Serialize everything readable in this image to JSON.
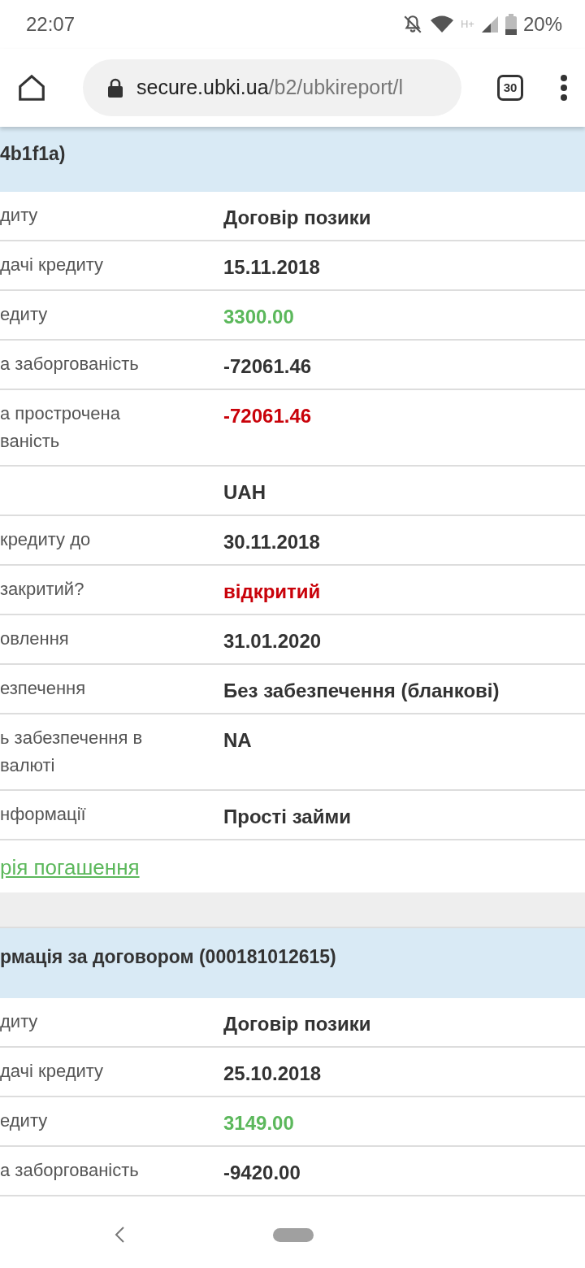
{
  "status_bar": {
    "time": "22:07",
    "network": "H+",
    "battery": "20%"
  },
  "browser": {
    "url_host": "secure.ubki.ua",
    "url_path": "/b2/ubkireport/l",
    "tab_count": "30"
  },
  "sections": [
    {
      "title": "4b1f1a)",
      "rows": [
        {
          "label": [
            "дитy"
          ],
          "value": "Договір позики",
          "color": "#333333"
        },
        {
          "label": [
            "дачі кредиту"
          ],
          "value": "15.11.2018",
          "color": "#333333"
        },
        {
          "label": [
            "едиту"
          ],
          "value": "3300.00",
          "color": "#5cb85c"
        },
        {
          "label": [
            "а заборгованість"
          ],
          "value": "-72061.46",
          "color": "#333333"
        },
        {
          "label": [
            "а прострочена",
            "ваність"
          ],
          "value": "-72061.46",
          "color": "#c9020a"
        },
        {
          "label": [],
          "value": "UAH",
          "color": "#333333"
        },
        {
          "label": [
            "кредиту до"
          ],
          "value": "30.11.2018",
          "color": "#333333"
        },
        {
          "label": [
            "закритий?"
          ],
          "value": "відкритий",
          "color": "#c9020a"
        },
        {
          "label": [
            "овлення"
          ],
          "value": "31.01.2020",
          "color": "#333333"
        },
        {
          "label": [
            "езпечення"
          ],
          "value": "Без забезпечення (бланкові)",
          "color": "#333333"
        },
        {
          "label": [
            "ь забезпечення в",
            "валюті"
          ],
          "value": "NA",
          "color": "#333333"
        },
        {
          "label": [
            "нформації"
          ],
          "value": "Прості займи",
          "color": "#333333"
        }
      ],
      "link": "рія погашення"
    },
    {
      "title": "рмація за договором (000181012615)",
      "rows": [
        {
          "label": [
            "дитy"
          ],
          "value": "Договір позики",
          "color": "#333333"
        },
        {
          "label": [
            "дачі кредиту"
          ],
          "value": "25.10.2018",
          "color": "#333333"
        },
        {
          "label": [
            "едиту"
          ],
          "value": "3149.00",
          "color": "#5cb85c"
        },
        {
          "label": [
            "а заборгованість"
          ],
          "value": "-9420.00",
          "color": "#333333"
        }
      ]
    }
  ]
}
